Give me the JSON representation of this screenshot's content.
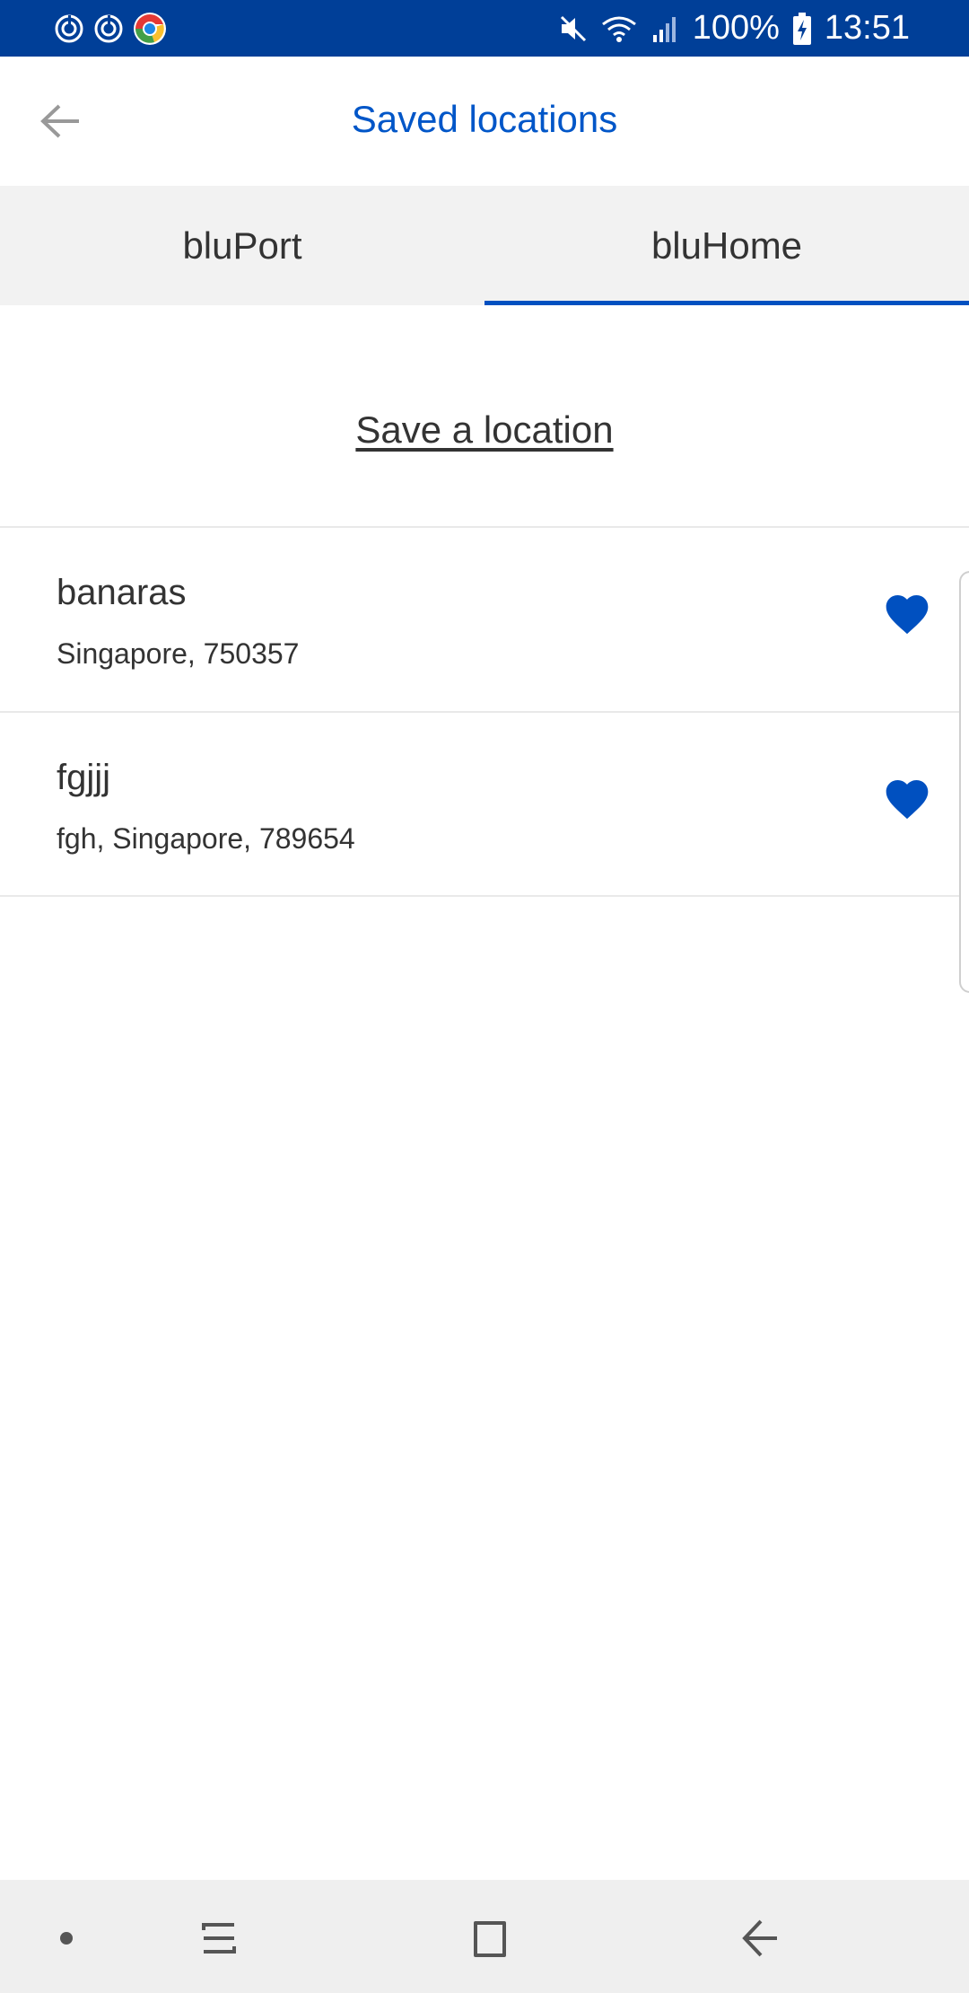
{
  "status_bar": {
    "battery": "100%",
    "time": "13:51",
    "icons": [
      "notification-icon",
      "notification-icon",
      "chrome-icon",
      "mute-icon",
      "wifi-icon",
      "signal-icon",
      "battery-charging-icon"
    ]
  },
  "header": {
    "title": "Saved locations",
    "back_icon": "arrow-left-icon"
  },
  "tabs": [
    {
      "label": "bluPort",
      "active": false
    },
    {
      "label": "bluHome",
      "active": true
    }
  ],
  "save_location_label": "Save a location",
  "locations": [
    {
      "name": "banaras",
      "address": "Singapore, 750357",
      "favorite": true
    },
    {
      "name": "fgjjj",
      "address": "fgh, Singapore, 789654",
      "favorite": true
    }
  ],
  "nav_bar": {
    "icons": [
      "dot-icon",
      "recent-apps-icon",
      "home-icon",
      "back-icon"
    ]
  },
  "colors": {
    "status_bar": "#003f98",
    "accent": "#0056c8",
    "heart": "#0050c0",
    "tab_bar": "#f2f2f2",
    "nav_bar": "#efefef"
  }
}
